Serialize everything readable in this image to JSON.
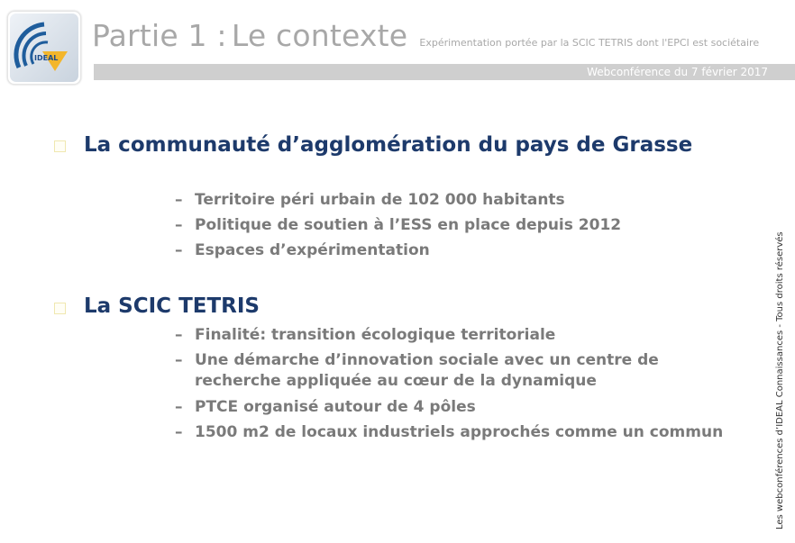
{
  "header": {
    "logo_label": "IDEAL",
    "title": "Partie 1 :",
    "title_section": "Le contexte",
    "subtitle": "Expérimentation portée par la SCIC TETRIS dont l'EPCI est sociétaire",
    "date_band": "Webconférence du 7 février 2017"
  },
  "sections": [
    {
      "heading": "La communauté d’agglomération du pays de Grasse",
      "items": [
        "Territoire péri urbain de 102 000 habitants",
        "Politique de soutien à l’ESS en place depuis 2012",
        "Espaces d’expérimentation"
      ]
    },
    {
      "heading": "La SCIC TETRIS",
      "items": [
        "Finalité:  transition écologique territoriale",
        "Une démarche d’innovation sociale avec un centre de recherche appliquée au cœur de la dynamique",
        "PTCE organisé autour de 4 pôles",
        "1500 m2 de locaux industriels approchés comme un commun"
      ]
    }
  ],
  "dash": "–",
  "side_note": "Les webconférences d’IDEAL Connaissances - Tous droits réservés",
  "colors": {
    "heading": "#1d3a6b",
    "sub": "#7a7a7a",
    "title": "#a8a8a8",
    "band": "#cfcfcf"
  }
}
